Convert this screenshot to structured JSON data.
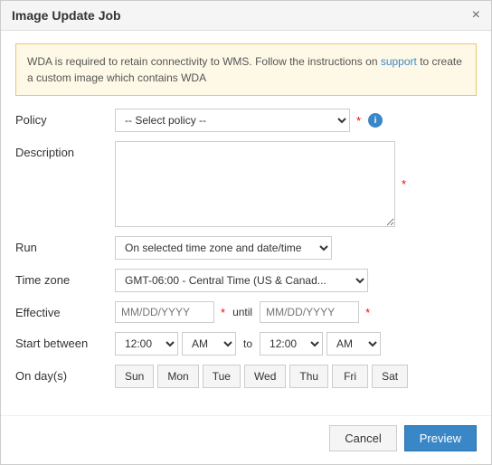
{
  "dialog": {
    "title": "Image Update Job",
    "close_label": "×"
  },
  "alert": {
    "text_before": "WDA is required to retain connectivity to WMS. Follow the instructions on ",
    "link_text": "support",
    "text_after": " to create a custom image which contains WDA"
  },
  "form": {
    "policy_label": "Policy",
    "policy_placeholder": "-- Select policy --",
    "description_label": "Description",
    "run_label": "Run",
    "run_placeholder": "On selected time zone and date/time",
    "timezone_label": "Time zone",
    "timezone_placeholder": "GMT-06:00 - Central Time (US & Canad...",
    "effective_label": "Effective",
    "effective_from_placeholder": "MM/DD/YYYY",
    "effective_until_placeholder": "MM/DD/YYYY",
    "until_text": "until",
    "start_between_label": "Start between",
    "to_text": "to",
    "time_start": "12:00",
    "time_end": "12:00",
    "ampm_start": "AM",
    "ampm_end": "AM",
    "on_days_label": "On day(s)",
    "days": [
      "Sun",
      "Mon",
      "Tue",
      "Wed",
      "Thu",
      "Fri",
      "Sat"
    ]
  },
  "footer": {
    "cancel_label": "Cancel",
    "preview_label": "Preview"
  }
}
